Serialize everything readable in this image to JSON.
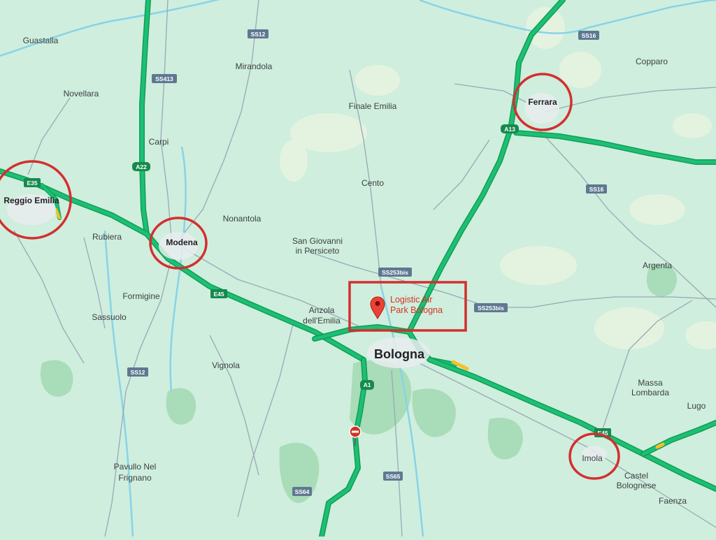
{
  "map": {
    "places": {
      "guastalla": "Guastalla",
      "novellara": "Novellara",
      "mirandola": "Mirandola",
      "finale_emilia": "Finale Emilia",
      "copparo": "Copparo",
      "ferrara": "Ferrara",
      "carpi": "Carpi",
      "reggio_emilia": "Reggio Emilia",
      "rubiera": "Rubiera",
      "modena": "Modena",
      "nonantola": "Nonantola",
      "cento": "Cento",
      "san_giovanni_1": "San Giovanni",
      "san_giovanni_2": "in Persiceto",
      "argenta": "Argenta",
      "formigine": "Formigine",
      "sassuolo": "Sassuolo",
      "anzola_1": "Anzola",
      "anzola_2": "dell'Emilia",
      "bologna": "Bologna",
      "vignola": "Vignola",
      "massa_1": "Massa",
      "massa_2": "Lombarda",
      "lugo": "Lugo",
      "imola": "Imola",
      "castel_1": "Castel",
      "castel_2": "Bolognese",
      "faenza": "Faenza",
      "pavullo_1": "Pavullo Nel",
      "pavullo_2": "Frignano"
    },
    "shields": {
      "ss12_top": "SS12",
      "ss16_top": "SS16",
      "ss413": "SS413",
      "a13": "A13",
      "a22": "A22",
      "e35": "E35",
      "ss16_mid": "SS16",
      "ss253bis_1": "SS253bis",
      "ss253bis_2": "SS253bis",
      "e45_west": "E45",
      "ss12_bottom": "SS12",
      "a1": "A1",
      "e45_east": "E45",
      "ss65": "SS65",
      "ss64": "SS64"
    },
    "poi": {
      "line1": "Logistic Air",
      "line2": "Park Bologna",
      "icon": "map-pin-icon",
      "color": "#d93025"
    },
    "colors": {
      "land": "#cfeedd",
      "highway": "#1dbf73",
      "highway_edge": "#0f9d58",
      "road": "#9aa8b7",
      "water": "#88d3e8",
      "highlight": "#d32f2f"
    }
  }
}
